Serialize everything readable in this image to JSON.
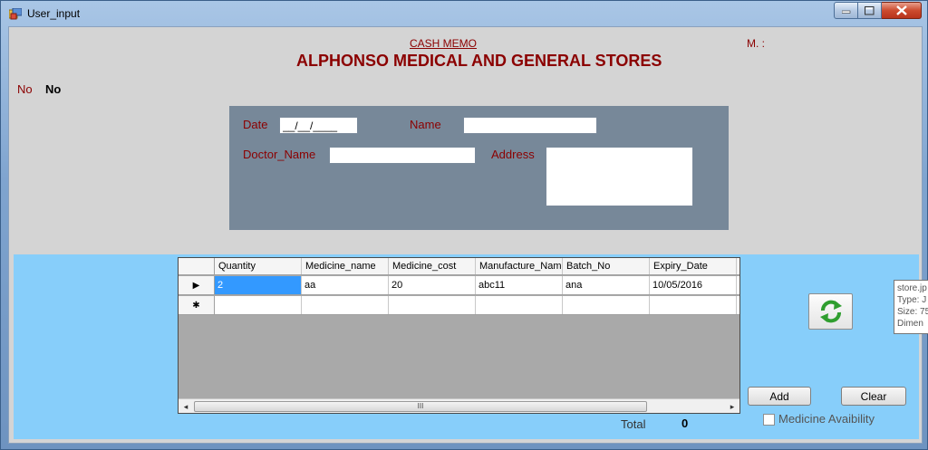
{
  "window": {
    "title": "User_input"
  },
  "header": {
    "cash_memo": "CASH MEMO",
    "store_name": "ALPHONSO MEDICAL AND GENERAL STORES",
    "m_label": "M. :",
    "no_label": "No",
    "no_value": "No"
  },
  "form": {
    "date_label": "Date",
    "date_value": "__/__/____",
    "name_label": "Name",
    "name_value": "",
    "doctor_label": "Doctor_Name",
    "doctor_value": "",
    "address_label": "Address",
    "address_value": ""
  },
  "grid": {
    "columns": [
      "Quantity",
      "Medicine_name",
      "Medicine_cost",
      "Manufacture_Name",
      "Batch_No",
      "Expiry_Date"
    ],
    "rows": [
      [
        "2",
        "aa",
        "20",
        "abc11",
        "ana",
        "10/05/2016"
      ]
    ],
    "current_row_marker": "▶",
    "new_row_marker": "✱",
    "scroll_left": "◂",
    "scroll_right": "▸",
    "scroll_grip": "III"
  },
  "actions": {
    "add_label": "Add",
    "clear_label": "Clear",
    "refresh_icon": "refresh-icon"
  },
  "footer": {
    "total_label": "Total",
    "total_value": "0",
    "availability_label": "Medicine Avaibility",
    "availability_checked": false
  },
  "tooltip": {
    "lines": [
      "store.jp",
      "Type: J",
      "Size: 75",
      "Dimen"
    ]
  },
  "colors": {
    "title_red": "#8b0000",
    "form_panel": "#778899",
    "grid_panel": "#87cefa",
    "selection": "#3399ff"
  }
}
